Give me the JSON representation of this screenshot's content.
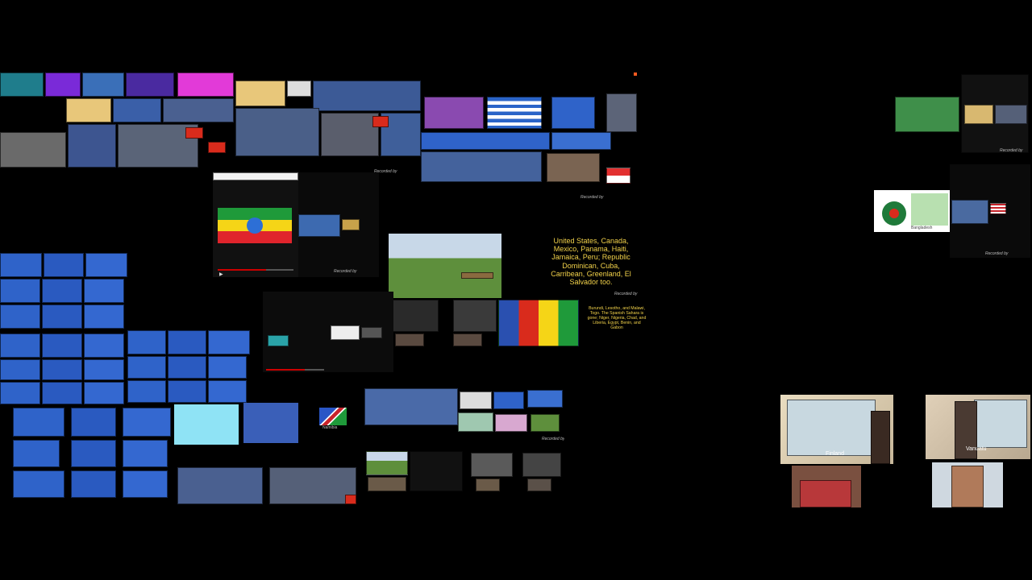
{
  "scene": {
    "background": "#000000",
    "palette": {
      "map_blue": "#2f63c9",
      "map_dark": "#16306e",
      "magenta": "#e23ad8",
      "pink": "#ff2aa6",
      "grey": "#7a7a7a",
      "cream": "#e8d8a8",
      "red": "#d92b1c",
      "yellow_text": "#f2d24a"
    }
  },
  "labels": {
    "recorded_by": "Recorded by",
    "namibia": "Namibia",
    "bangladesh": "Bangladesh",
    "finland": "Finland",
    "vanuatu": "Vanuatu"
  },
  "captions": {
    "americas": "United States, Canada, Mexico, Panama, Haiti, Jamaica, Peru; Republic Dominican, Cuba, Carribean, Greenland, El Salvador too.",
    "africa": "Burundi, Lesotho, and Malawi, Togo. The Spanish Sahara is gone; Niger, Nigeria, Chad, and Liberia, Egypt, Benin, and Gabon"
  },
  "icons": {
    "ethiopia_flag": "ethiopia-flag-icon",
    "greece_flag": "greece-flag-icon",
    "namibia_flag": "namibia-flag-icon",
    "bangladesh_ball": "bangladesh-ball-icon",
    "play": "play-icon"
  }
}
